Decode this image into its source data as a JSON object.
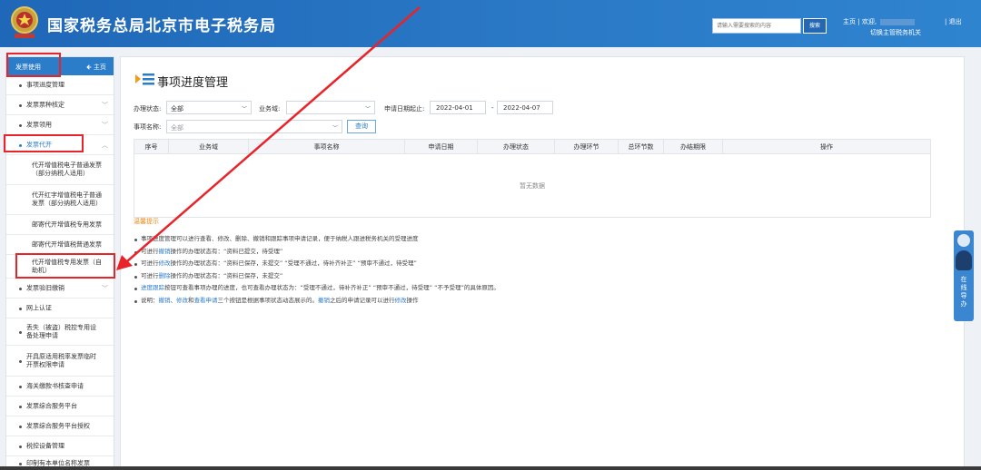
{
  "header": {
    "title": "国家税务总局北京市电子税务局",
    "search_placeholder": "请输入需要搜索的内容",
    "search_button": "搜索",
    "home_link": "主页",
    "welcome": "欢迎,",
    "switch_org": "切换主管税务机关",
    "logout": "退出",
    "bg_color": "#2a79c6"
  },
  "sidebar": {
    "header_title": "发票使用",
    "header_home": "主页",
    "items": [
      {
        "label": "事项进度管理",
        "chevron": ""
      },
      {
        "label": "发票票种核定",
        "chevron": "﹀"
      },
      {
        "label": "发票领用",
        "chevron": "﹀"
      },
      {
        "label": "发票代开",
        "chevron": "︿"
      },
      {
        "label": "代开增值税电子普通发票（部分纳税人适用）"
      },
      {
        "label": "代开红字增值税电子普通发票（部分纳税人适用）"
      },
      {
        "label": "邮寄代开增值税专用发票"
      },
      {
        "label": "邮寄代开增值税普通发票"
      },
      {
        "label": "代开增值税专用发票（自助机）"
      },
      {
        "label": "发票验旧缴销",
        "chevron": "﹀"
      },
      {
        "label": "网上认证",
        "chevron": ""
      },
      {
        "label": "丢失（被盗）税控专用设备处理申请",
        "chevron": ""
      },
      {
        "label": "开具原适用税率发票临时开票权限申请",
        "chevron": ""
      },
      {
        "label": "海关缴款书核查申请",
        "chevron": ""
      },
      {
        "label": "发票综合服务平台",
        "chevron": ""
      },
      {
        "label": "发票综合服务平台授权",
        "chevron": ""
      },
      {
        "label": "税控设备管理",
        "chevron": ""
      },
      {
        "label": "印制有本单位名称发票",
        "chevron": ""
      }
    ]
  },
  "main": {
    "title": "事项进度管理",
    "filters": {
      "status_label": "办理状态:",
      "status_value": "全部",
      "business_label": "业务域:",
      "business_value": "",
      "date_label": "申请日期起止:",
      "date_from": "2022-04-01",
      "date_sep": "-",
      "date_to": "2022-04-07",
      "item_label": "事项名称:",
      "item_value": "全部",
      "query_button": "查询"
    },
    "table": {
      "columns": [
        "序号",
        "业务域",
        "事项名称",
        "申请日期",
        "办理状态",
        "办理环节",
        "总环节数",
        "办结期限",
        "操作"
      ],
      "empty_text": "暂无数据"
    },
    "tips_title": "温馨提示",
    "tips": [
      [
        {
          "t": "事项进度管理可以进行查看、修改、删除、撤销和跟踪事项申请记录，便于纳税人跟进税务机关的受理进度"
        }
      ],
      [
        {
          "t": "可进行"
        },
        {
          "t": "撤销",
          "link": true
        },
        {
          "t": "操作的办理状态有：“资料已提交，待受理”"
        }
      ],
      [
        {
          "t": "可进行"
        },
        {
          "t": "修改",
          "link": true
        },
        {
          "t": "操作的办理状态有：“资料已保存，未提交”  “受理不通过，待补齐补正”  “预审不通过，待受理”"
        }
      ],
      [
        {
          "t": "可进行"
        },
        {
          "t": "删除",
          "link": true
        },
        {
          "t": "操作的办理状态有：“资料已保存，未提交”"
        }
      ],
      [
        {
          "t": "进度跟踪",
          "link": true
        },
        {
          "t": "按钮可查看事项办理的进度，也可查看办理状态为：“受理不通过，待补齐补正”  “预审不通过，待受理”  “不予受理”的具体原因。"
        }
      ],
      [
        {
          "t": "说明："
        },
        {
          "t": "撤销",
          "link": true
        },
        {
          "t": "、"
        },
        {
          "t": "修改",
          "link": true
        },
        {
          "t": "和"
        },
        {
          "t": "查看申请",
          "link": true
        },
        {
          "t": "三个按钮是根据事项状态动态展示的。"
        },
        {
          "t": "撤销",
          "link": true
        },
        {
          "t": "之后的申请记录可以进行"
        },
        {
          "t": "修改",
          "link": true
        },
        {
          "t": "操作"
        }
      ]
    ]
  },
  "helper": {
    "label": "在线导办"
  },
  "annotation_color": "#e8232a"
}
